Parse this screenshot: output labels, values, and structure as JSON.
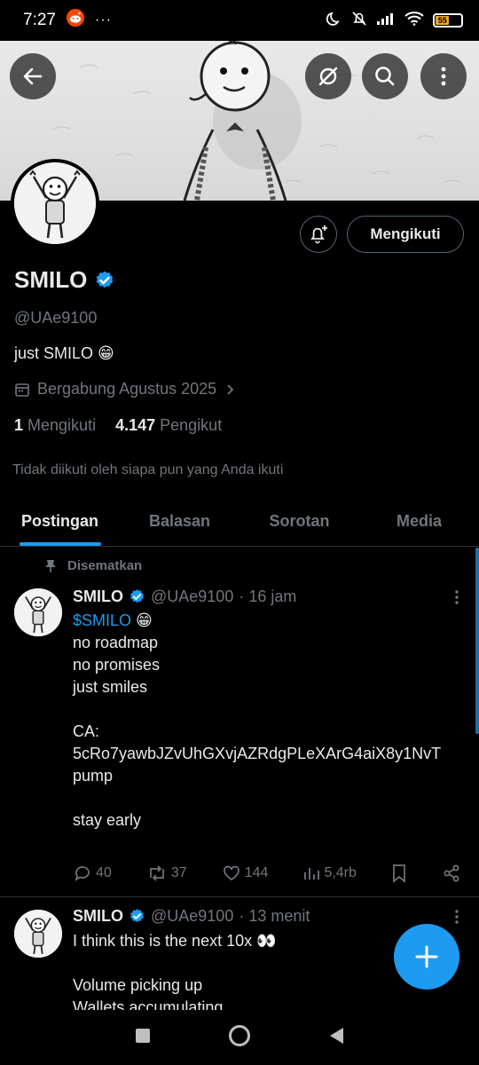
{
  "status_bar": {
    "time": "7:27",
    "battery_level": "55",
    "icons": [
      "reddit-icon",
      "more-dots-icon",
      "moon-icon",
      "bell-off-icon",
      "signal-icon",
      "wifi-icon",
      "battery-icon"
    ]
  },
  "header": {
    "follow_label": "Mengikuti",
    "icons": [
      "back-arrow-icon",
      "grok-icon",
      "search-icon",
      "more-vertical-icon",
      "bell-plus-icon"
    ]
  },
  "profile": {
    "name": "SMILO",
    "handle": "@UAe9100",
    "bio": "just SMILO 😁",
    "joined": "Bergabung Agustus 2025",
    "following_count": "1",
    "following_label": "Mengikuti",
    "followers_count": "4.147",
    "followers_label": "Pengikut",
    "followed_note": "Tidak diikuti oleh siapa pun yang Anda ikuti"
  },
  "tabs": [
    {
      "label": "Postingan",
      "active": true
    },
    {
      "label": "Balasan",
      "active": false
    },
    {
      "label": "Sorotan",
      "active": false
    },
    {
      "label": "Media",
      "active": false
    }
  ],
  "tweets": [
    {
      "pinned_label": "Disematkan",
      "name": "SMILO",
      "handle": "@UAe9100",
      "time": "· 16 jam",
      "cashtag": "$SMILO",
      "emoji": " 😁",
      "lines": [
        "no roadmap",
        "no promises",
        "just smiles",
        "",
        "CA:",
        "5cRo7yawbJZvUhGXvjAZRdgPLeXArG4aiX8y1NvT",
        "pump",
        "",
        "stay early"
      ],
      "replies": "40",
      "reposts": "37",
      "likes": "144",
      "views": "5,4rb"
    },
    {
      "name": "SMILO",
      "handle": "@UAe9100",
      "time": "· 13 menit",
      "lines": [
        "I think this is the next 10x 👀",
        "",
        "Volume picking up",
        "Wallets accumulating"
      ]
    }
  ],
  "colors": {
    "accent": "#1d9bf0",
    "background": "#000000",
    "text": "#e7e9ea",
    "muted": "#71767b"
  }
}
